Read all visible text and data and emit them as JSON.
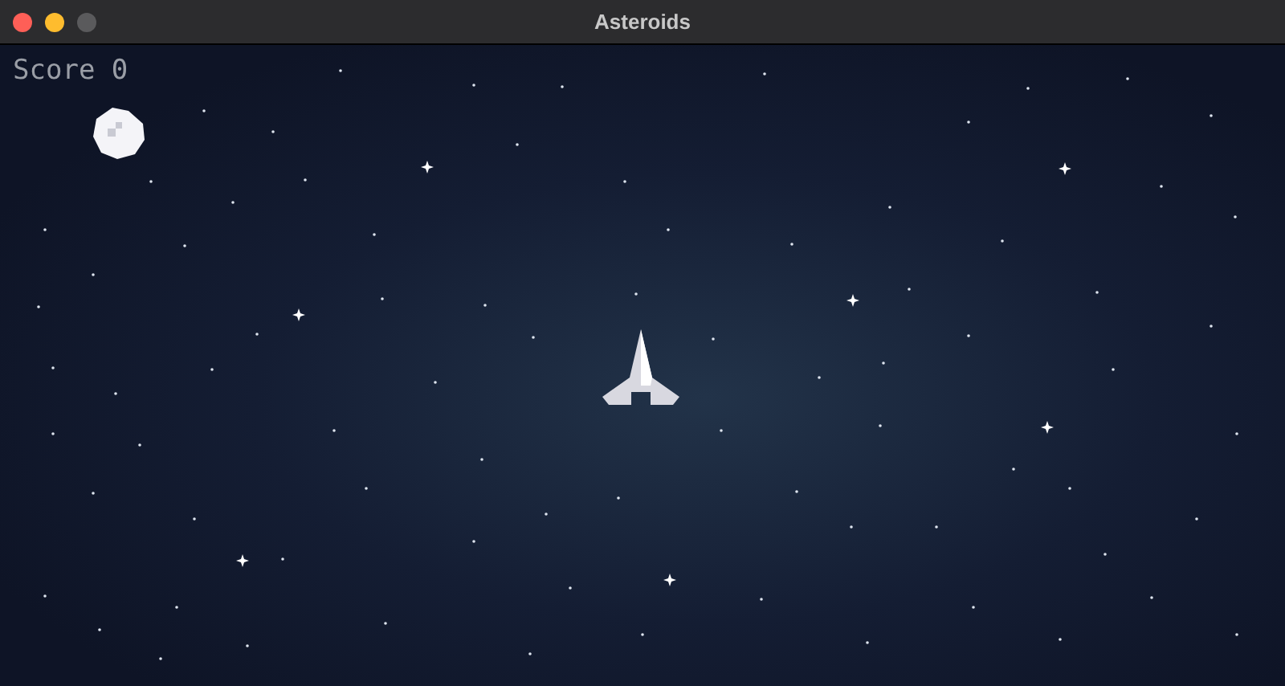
{
  "window": {
    "title": "Asteroids",
    "controls": [
      {
        "kind": "close",
        "disabled": false
      },
      {
        "kind": "minimize",
        "disabled": false
      },
      {
        "kind": "zoom",
        "disabled": true
      }
    ]
  },
  "game": {
    "score": "Score 0"
  }
}
